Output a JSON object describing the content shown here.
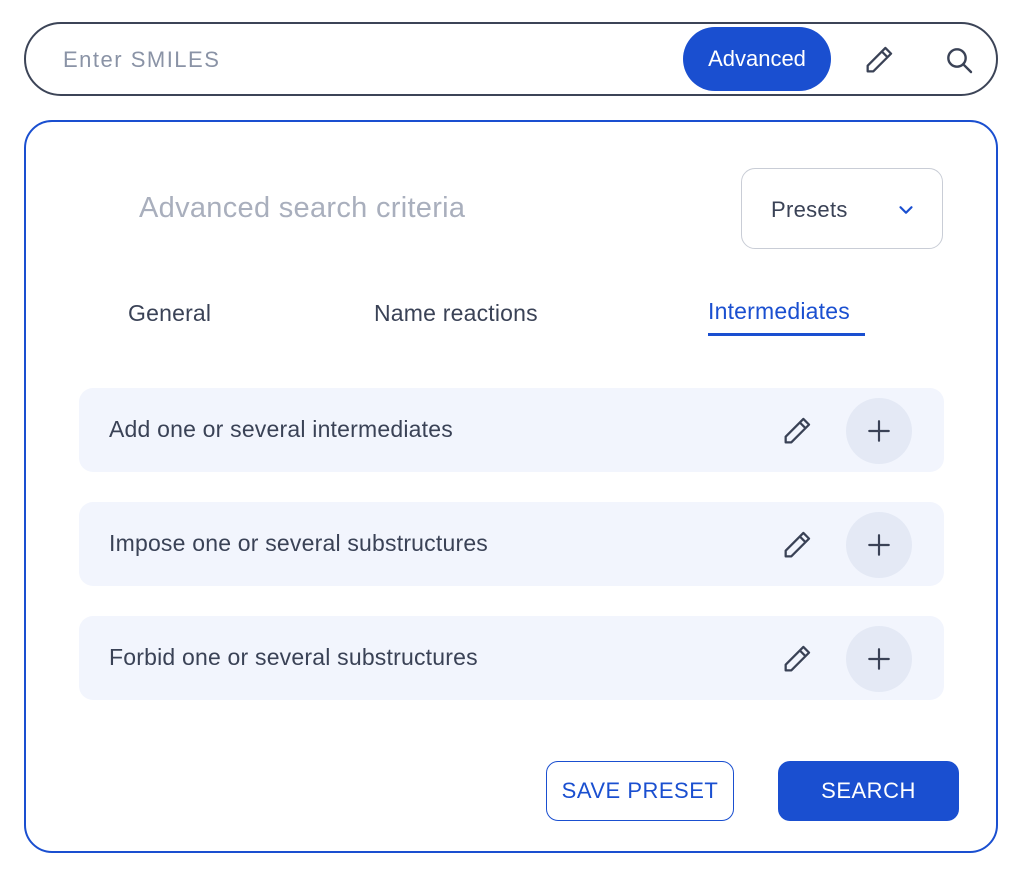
{
  "search_bar": {
    "placeholder": "Enter SMILES",
    "advanced_label": "Advanced",
    "edit_icon": "pencil-icon",
    "search_icon": "magnifier-icon"
  },
  "panel": {
    "title": "Advanced search criteria",
    "presets_label": "Presets",
    "presets_icon": "chevron-down-icon",
    "tabs": [
      {
        "label": "General",
        "active": false
      },
      {
        "label": "Name reactions",
        "active": false
      },
      {
        "label": "Intermediates",
        "active": true
      }
    ],
    "rows": [
      {
        "label": "Add one or several intermediates"
      },
      {
        "label": "Impose one or several substructures"
      },
      {
        "label": "Forbid one or several substructures"
      }
    ],
    "save_preset_label": "SAVE PRESET",
    "search_label": "SEARCH"
  },
  "colors": {
    "accent": "#1a4fd0",
    "row_background": "#f2f5fd",
    "add_button_background": "#e4e9f5",
    "text": "#3a4256",
    "muted_text": "#a9afbd"
  }
}
